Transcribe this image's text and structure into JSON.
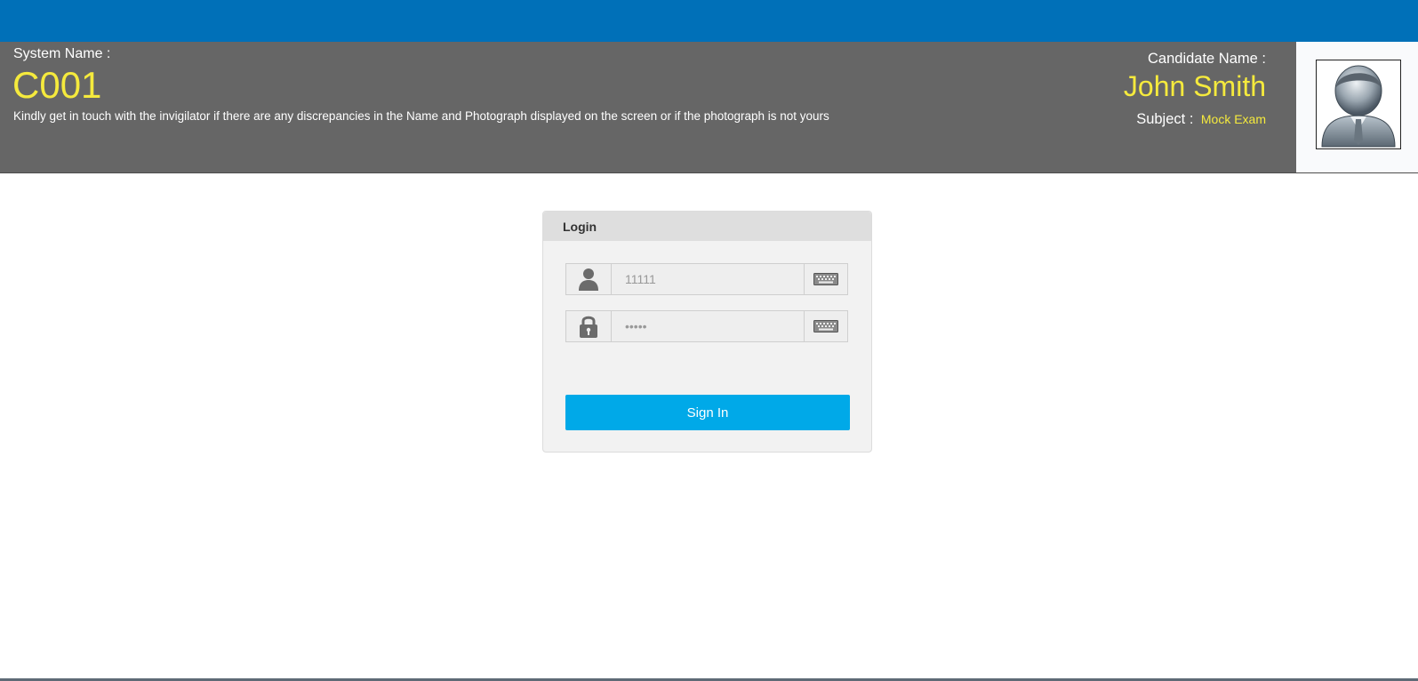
{
  "header": {
    "system_label": "System Name :",
    "system_value": "C001",
    "notice": "Kindly get in touch with the invigilator if there are any discrepancies in the Name and Photograph displayed on the screen or if the photograph is not yours",
    "candidate_label": "Candidate Name :",
    "candidate_value": "John Smith",
    "subject_label": "Subject :",
    "subject_value": "Mock Exam"
  },
  "login": {
    "title": "Login",
    "username_value": "11111",
    "password_value": "•••••",
    "sign_in_label": "Sign In",
    "user_icon": "user-icon",
    "lock_icon": "lock-icon",
    "keyboard_icon": "keyboard-icon"
  },
  "colors": {
    "top_bar": "#0070b8",
    "header_bg": "#666666",
    "highlight_text": "#f5ea3d",
    "sign_in_button": "#00a9e8"
  }
}
